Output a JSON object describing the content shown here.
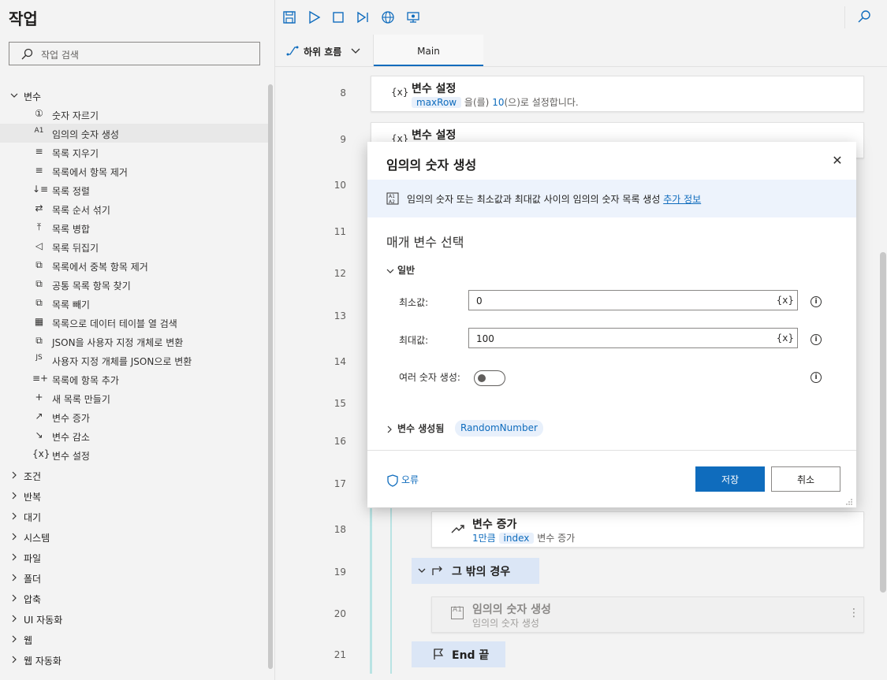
{
  "actions_pane": {
    "title": "작업",
    "search_placeholder": "작업 검색",
    "open_category": "변수",
    "items": [
      {
        "icon": "①",
        "label": "숫자 자르기"
      },
      {
        "icon": "A1",
        "label": "임의의 숫자 생성"
      },
      {
        "icon": "≡",
        "label": "목록 지우기"
      },
      {
        "icon": "≡",
        "label": "목록에서 항목 제거"
      },
      {
        "icon": "↓≡",
        "label": "목록 정렬"
      },
      {
        "icon": "⇄",
        "label": "목록 순서 섞기"
      },
      {
        "icon": "⤒",
        "label": "목록 병합"
      },
      {
        "icon": "◁",
        "label": "목록 뒤집기"
      },
      {
        "icon": "⧉",
        "label": "목록에서 중복 항목 제거"
      },
      {
        "icon": "⧉",
        "label": "공통 목록 항목 찾기"
      },
      {
        "icon": "⧉",
        "label": "목록 빼기"
      },
      {
        "icon": "▦",
        "label": "목록으로 데이터 테이블 열 검색"
      },
      {
        "icon": "⧉",
        "label": "JSON을 사용자 지정 개체로 변환"
      },
      {
        "icon": "JS",
        "label": "사용자 지정 개체를 JSON으로 변환"
      },
      {
        "icon": "≡+",
        "label": "목록에 항목 추가"
      },
      {
        "icon": "+",
        "label": "새 목록 만들기"
      },
      {
        "icon": "↗",
        "label": "변수 증가"
      },
      {
        "icon": "↘",
        "label": "변수 감소"
      },
      {
        "icon": "{x}",
        "label": "변수 설정"
      }
    ],
    "categories": [
      "조건",
      "반복",
      "대기",
      "시스템",
      "파일",
      "폴더",
      "압축",
      "UI 자동화",
      "웹",
      "웹 자동화"
    ]
  },
  "tabs": {
    "subflow_label": "하위 흐름",
    "main_label": "Main"
  },
  "canvas": {
    "line_numbers": [
      "8",
      "9",
      "10",
      "11",
      "12",
      "13",
      "14",
      "15",
      "16",
      "17",
      "18",
      "19",
      "20",
      "21"
    ],
    "card8": {
      "icon": "{x}",
      "title": "변수 설정",
      "var": "maxRow",
      "text1": " 을(를) ",
      "num": "10",
      "text2": "(으)로 설정합니다."
    },
    "card9": {
      "icon": "{x}",
      "title": "변수 설정"
    },
    "card18": {
      "title": "변수 증가",
      "prefix": "1만큼 ",
      "var": "index",
      "suffix": " 변수 증가"
    },
    "else_label": "그 밖의 경우",
    "card20": {
      "icon": "A1",
      "title": "임의의 숫자 생성",
      "sub": "임의의 숫자 생성"
    },
    "end_label": "End 끝"
  },
  "dialog": {
    "title": "임의의 숫자 생성",
    "info_text": "임의의 숫자 또는 최소값과 최대값 사이의 임의의 숫자 목록 생성 ",
    "info_link": "추가 정보",
    "params_title": "매개 변수 선택",
    "general_label": "일반",
    "min_label": "최소값:",
    "min_value": "0",
    "max_label": "최대값:",
    "max_value": "100",
    "var_token": "{x}",
    "multi_label": "여러 숫자 생성:",
    "multi_enabled": false,
    "vars_made_label": "변수 생성됨",
    "var_name": "RandomNumber",
    "errors_label": "오류",
    "save_label": "저장",
    "cancel_label": "취소"
  },
  "colors": {
    "accent": "#0f6cbd",
    "info_bg": "#edf3fc"
  }
}
